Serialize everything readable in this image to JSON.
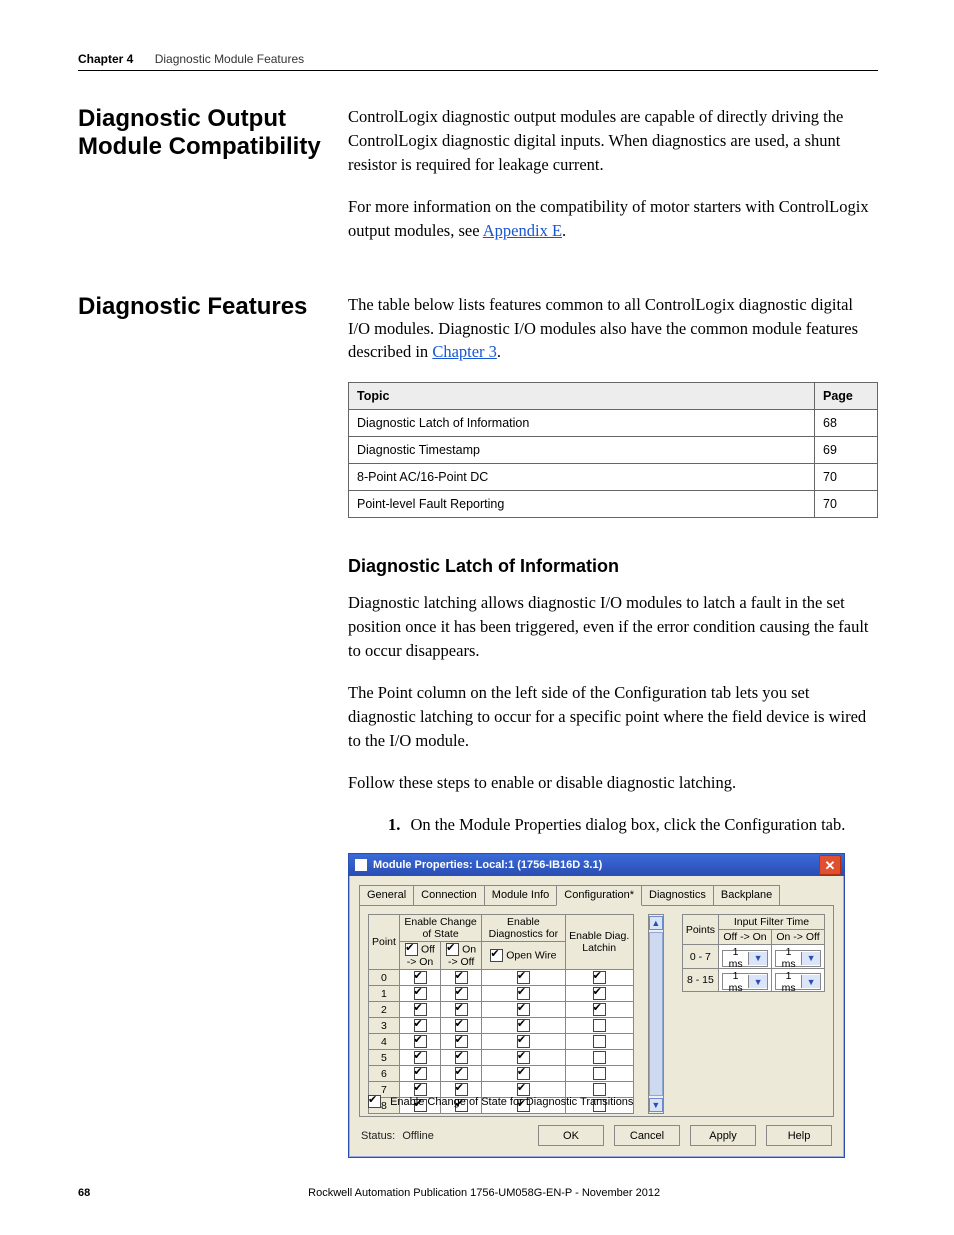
{
  "runhead": {
    "chapter": "Chapter 4",
    "title": "Diagnostic Module Features"
  },
  "sections": {
    "compat": {
      "heading": "Diagnostic Output Module Compatibility",
      "p1": "ControlLogix diagnostic output modules are capable of directly driving the ControlLogix diagnostic digital inputs. When diagnostics are used, a shunt resistor is required for leakage current.",
      "p2a": "For more information on the compatibility of motor starters with ControlLogix output modules, see ",
      "p2link": "Appendix E",
      "p2b": "."
    },
    "features": {
      "heading": "Diagnostic Features",
      "p1a": "The table below lists features common to all ControlLogix diagnostic digital I/O modules.  Diagnostic I/O modules also have the common module features described in ",
      "p1link": "Chapter 3",
      "p1b": "."
    }
  },
  "topics_table": {
    "headers": [
      "Topic",
      "Page"
    ],
    "rows": [
      [
        "Diagnostic Latch of Information",
        "68"
      ],
      [
        "Diagnostic Timestamp",
        "69"
      ],
      [
        "8-Point AC/16-Point DC",
        "70"
      ],
      [
        "Point-level Fault Reporting",
        "70"
      ]
    ]
  },
  "latch": {
    "heading": "Diagnostic Latch of Information",
    "p1": "Diagnostic latching allows diagnostic I/O modules to latch a fault in the set position once it has been triggered, even if the error condition causing the fault to occur disappears.",
    "p2": "The Point column on the left side of the Configuration tab lets you set diagnostic latching to occur for a specific point where the field device is wired to the I/O module.",
    "p3": "Follow these steps to enable or disable diagnostic latching.",
    "step1_num": "1.",
    "step1": "On the Module Properties dialog box, click the Configuration tab."
  },
  "dialog": {
    "title": "Module Properties: Local:1 (1756-IB16D 3.1)",
    "tabs": [
      "General",
      "Connection",
      "Module Info",
      "Configuration*",
      "Diagnostics",
      "Backplane"
    ],
    "active_tab": 3,
    "grid": {
      "group_cos": "Enable Change of State",
      "group_diag": "Enable Diagnostics for",
      "h_point": "Point",
      "h_offon": "Off -> On",
      "h_onoff": "On -> Off",
      "h_openwire": "Open Wire",
      "h_latch": "Enable Diag. Latchin",
      "points": [
        "0",
        "1",
        "2",
        "3",
        "4",
        "5",
        "6",
        "7",
        "8"
      ],
      "hdr_checked": {
        "offon": true,
        "onoff": true,
        "openwire": true,
        "latch": false
      },
      "rows_checked": {
        "offon": [
          true,
          true,
          true,
          true,
          true,
          true,
          true,
          true,
          true
        ],
        "onoff": [
          true,
          true,
          true,
          true,
          true,
          true,
          true,
          true,
          true
        ],
        "openwire": [
          true,
          true,
          true,
          true,
          true,
          true,
          true,
          true,
          true
        ],
        "latch": [
          true,
          true,
          true,
          false,
          false,
          false,
          false,
          false,
          false
        ]
      }
    },
    "filter": {
      "title": "Input Filter Time",
      "h_points": "Points",
      "h_offon": "Off -> On",
      "h_onoff": "On -> Off",
      "rows": [
        {
          "range": "0 - 7",
          "offon": "1 ms",
          "onoff": "1 ms"
        },
        {
          "range": "8 - 15",
          "offon": "1 ms",
          "onoff": "1 ms"
        }
      ]
    },
    "cos_label": "Enable Change of State for Diagnostic Transitions",
    "cos_checked": true,
    "status_label": "Status:",
    "status_value": "Offline",
    "buttons": {
      "ok": "OK",
      "cancel": "Cancel",
      "apply": "Apply",
      "help": "Help"
    }
  },
  "footer": {
    "page": "68",
    "pub": "Rockwell Automation Publication 1756-UM058G-EN-P - November 2012"
  }
}
